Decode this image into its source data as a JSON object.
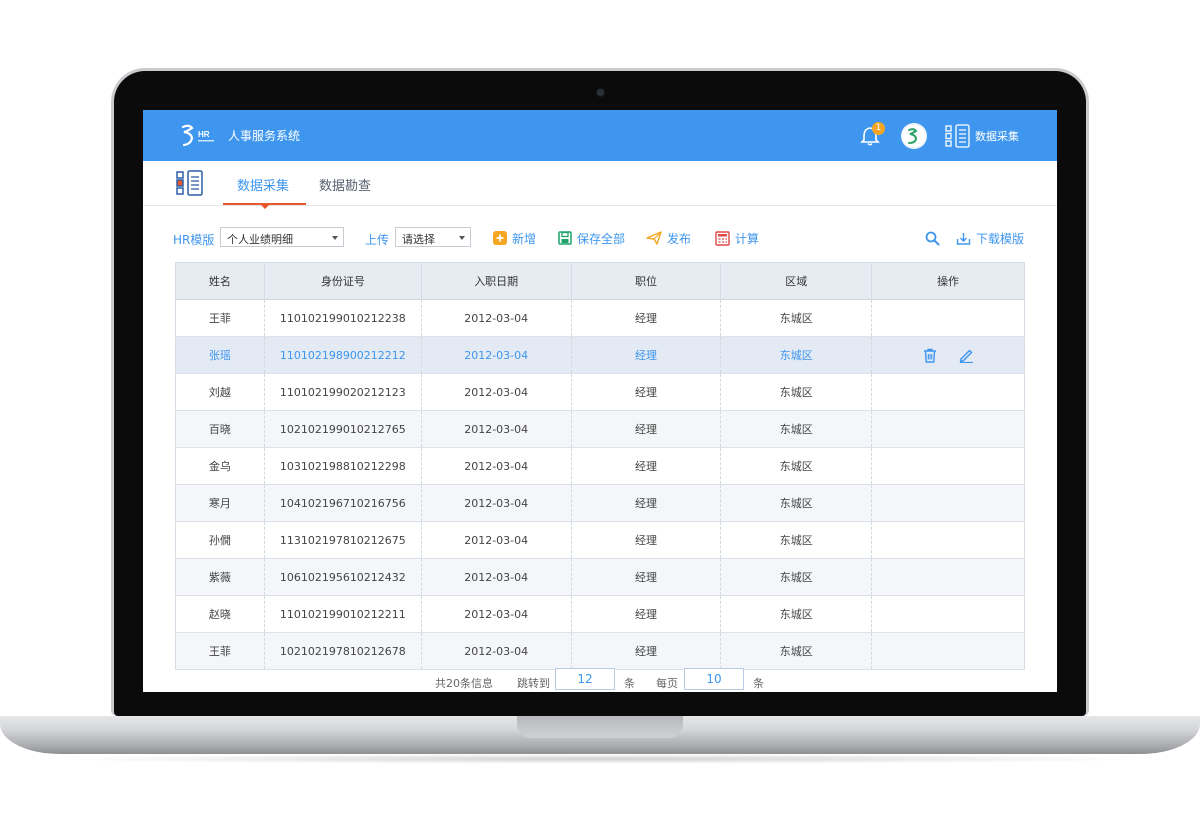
{
  "header": {
    "app_title": "人事服务系统",
    "logo_text": "HR",
    "notification_count": "1",
    "module_label": "数据采集",
    "brand_color": "#3e96ef"
  },
  "tabs": [
    {
      "label": "数据采集",
      "active": true
    },
    {
      "label": "数据勘查",
      "active": false
    }
  ],
  "toolbar": {
    "template_label": "HR模版",
    "template_value": "个人业绩明细",
    "upload_label": "上传",
    "upload_placeholder": "请选择",
    "add_label": "新增",
    "save_all_label": "保存全部",
    "publish_label": "发布",
    "calculate_label": "计算",
    "download_label": "下载模版"
  },
  "table": {
    "columns": [
      "姓名",
      "身份证号",
      "入职日期",
      "职位",
      "区域",
      "操作"
    ],
    "rows": [
      {
        "name": "王菲",
        "id": "110102199010212238",
        "date": "2012-03-04",
        "position": "经理",
        "region": "东城区"
      },
      {
        "name": "张瑶",
        "id": "110102198900212212",
        "date": "2012-03-04",
        "position": "经理",
        "region": "东城区"
      },
      {
        "name": "刘越",
        "id": "110102199020212123",
        "date": "2012-03-04",
        "position": "经理",
        "region": "东城区"
      },
      {
        "name": "百晓",
        "id": "102102199010212765",
        "date": "2012-03-04",
        "position": "经理",
        "region": "东城区"
      },
      {
        "name": "金乌",
        "id": "103102198810212298",
        "date": "2012-03-04",
        "position": "经理",
        "region": "东城区"
      },
      {
        "name": "寒月",
        "id": "104102196710216756",
        "date": "2012-03-04",
        "position": "经理",
        "region": "东城区"
      },
      {
        "name": "孙僩",
        "id": "113102197810212675",
        "date": "2012-03-04",
        "position": "经理",
        "region": "东城区"
      },
      {
        "name": "紫薇",
        "id": "106102195610212432",
        "date": "2012-03-04",
        "position": "经理",
        "region": "东城区"
      },
      {
        "name": "赵晓",
        "id": "110102199010212211",
        "date": "2012-03-04",
        "position": "经理",
        "region": "东城区"
      },
      {
        "name": "王菲",
        "id": "102102197810212678",
        "date": "2012-03-04",
        "position": "经理",
        "region": "东城区"
      }
    ]
  },
  "pager": {
    "total_text": "共20条信息",
    "jump_label": "跳转到",
    "jump_value": "12",
    "jump_unit": "条",
    "per_page_label": "每页",
    "per_page_value": "10",
    "per_page_unit": "条"
  }
}
